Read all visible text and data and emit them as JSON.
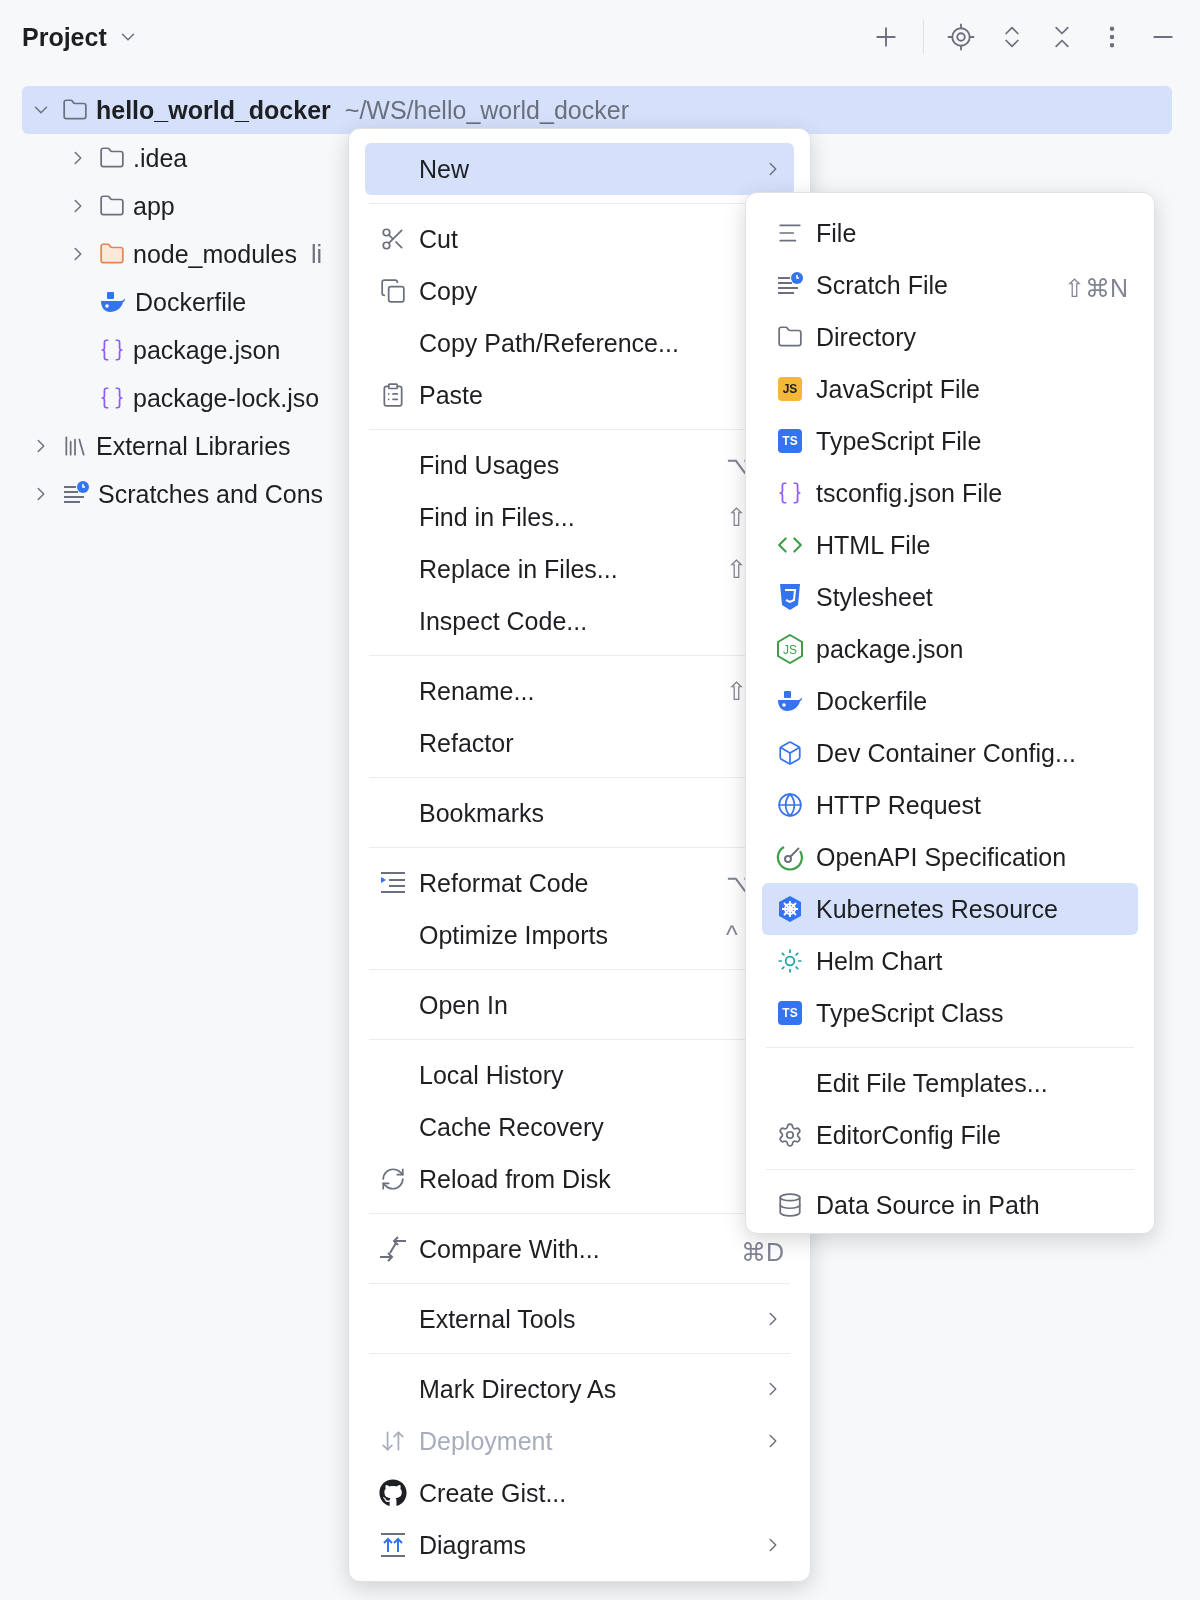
{
  "header": {
    "title": "Project"
  },
  "tree": [
    {
      "label": "hello_world_docker",
      "hint": "~/WS/hello_world_docker",
      "expanded": true,
      "selected": true,
      "children": [
        {
          "label": ".idea",
          "expanded": false,
          "selected": false
        },
        {
          "label": "app",
          "expanded": false,
          "selected": false
        },
        {
          "label": "node_modules",
          "hint": "li",
          "expanded": false,
          "selected": false
        },
        {
          "label": "Dockerfile",
          "selected": false
        },
        {
          "label": "package.json",
          "selected": false
        },
        {
          "label": "package-lock.jso",
          "selected": false
        }
      ]
    },
    {
      "label": "External Libraries",
      "expanded": false,
      "selected": false
    },
    {
      "label": "Scratches and Cons",
      "expanded": false,
      "selected": false
    }
  ],
  "context_menu": {
    "groups": [
      [
        {
          "label": "New",
          "selected": true,
          "submenu": true,
          "disabled": false
        }
      ],
      [
        {
          "label": "Cut",
          "selected": false,
          "submenu": false,
          "disabled": false
        },
        {
          "label": "Copy",
          "selected": false,
          "submenu": false,
          "disabled": false
        },
        {
          "label": "Copy Path/Reference...",
          "selected": false,
          "submenu": false,
          "disabled": false
        },
        {
          "label": "Paste",
          "selected": false,
          "submenu": false,
          "disabled": false
        }
      ],
      [
        {
          "label": "Find Usages",
          "shortcut": "⌥",
          "selected": false,
          "submenu": false,
          "disabled": false
        },
        {
          "label": "Find in Files...",
          "shortcut": "⇧",
          "selected": false,
          "submenu": false,
          "disabled": false
        },
        {
          "label": "Replace in Files...",
          "shortcut": "⇧",
          "selected": false,
          "submenu": false,
          "disabled": false
        },
        {
          "label": "Inspect Code...",
          "selected": false,
          "submenu": false,
          "disabled": false
        }
      ],
      [
        {
          "label": "Rename...",
          "shortcut": "⇧",
          "selected": false,
          "submenu": false,
          "disabled": false
        },
        {
          "label": "Refactor",
          "selected": false,
          "submenu": false,
          "disabled": false
        }
      ],
      [
        {
          "label": "Bookmarks",
          "selected": false,
          "submenu": false,
          "disabled": false
        }
      ],
      [
        {
          "label": "Reformat Code",
          "shortcut": "⌥",
          "selected": false,
          "submenu": false,
          "disabled": false
        },
        {
          "label": "Optimize Imports",
          "shortcut": "^",
          "selected": false,
          "submenu": false,
          "disabled": false
        }
      ],
      [
        {
          "label": "Open In",
          "selected": false,
          "submenu": false,
          "disabled": false
        }
      ],
      [
        {
          "label": "Local History",
          "selected": false,
          "submenu": false,
          "disabled": false
        },
        {
          "label": "Cache Recovery",
          "selected": false,
          "submenu": false,
          "disabled": false
        },
        {
          "label": "Reload from Disk",
          "selected": false,
          "submenu": false,
          "disabled": false
        }
      ],
      [
        {
          "label": "Compare With...",
          "shortcut": "⌘D",
          "selected": false,
          "submenu": false,
          "disabled": false
        }
      ],
      [
        {
          "label": "External Tools",
          "selected": false,
          "submenu": true,
          "disabled": false
        }
      ],
      [
        {
          "label": "Mark Directory As",
          "selected": false,
          "submenu": true,
          "disabled": false
        },
        {
          "label": "Deployment",
          "selected": false,
          "submenu": true,
          "disabled": true
        },
        {
          "label": "Create Gist...",
          "selected": false,
          "submenu": false,
          "disabled": false
        },
        {
          "label": "Diagrams",
          "selected": false,
          "submenu": true,
          "disabled": false
        }
      ]
    ]
  },
  "new_submenu": {
    "groups": [
      [
        {
          "label": "File",
          "selected": false
        },
        {
          "label": "Scratch File",
          "shortcut": "⇧⌘N",
          "selected": false
        },
        {
          "label": "Directory",
          "selected": false
        },
        {
          "label": "JavaScript File",
          "badge": "JS",
          "selected": false
        },
        {
          "label": "TypeScript File",
          "badge": "TS",
          "selected": false
        },
        {
          "label": "tsconfig.json File",
          "selected": false
        },
        {
          "label": "HTML File",
          "selected": false
        },
        {
          "label": "Stylesheet",
          "selected": false
        },
        {
          "label": "package.json",
          "badge": "JS",
          "selected": false
        },
        {
          "label": "Dockerfile",
          "selected": false
        },
        {
          "label": "Dev Container Config...",
          "selected": false
        },
        {
          "label": "HTTP Request",
          "selected": false
        },
        {
          "label": "OpenAPI Specification",
          "selected": false
        },
        {
          "label": "Kubernetes Resource",
          "selected": true
        },
        {
          "label": "Helm Chart",
          "selected": false
        },
        {
          "label": "TypeScript Class",
          "badge": "TS",
          "selected": false
        }
      ],
      [
        {
          "label": "Edit File Templates...",
          "selected": false
        },
        {
          "label": "EditorConfig File",
          "selected": false
        }
      ],
      [
        {
          "label": "Data Source in Path",
          "selected": false
        }
      ]
    ]
  }
}
